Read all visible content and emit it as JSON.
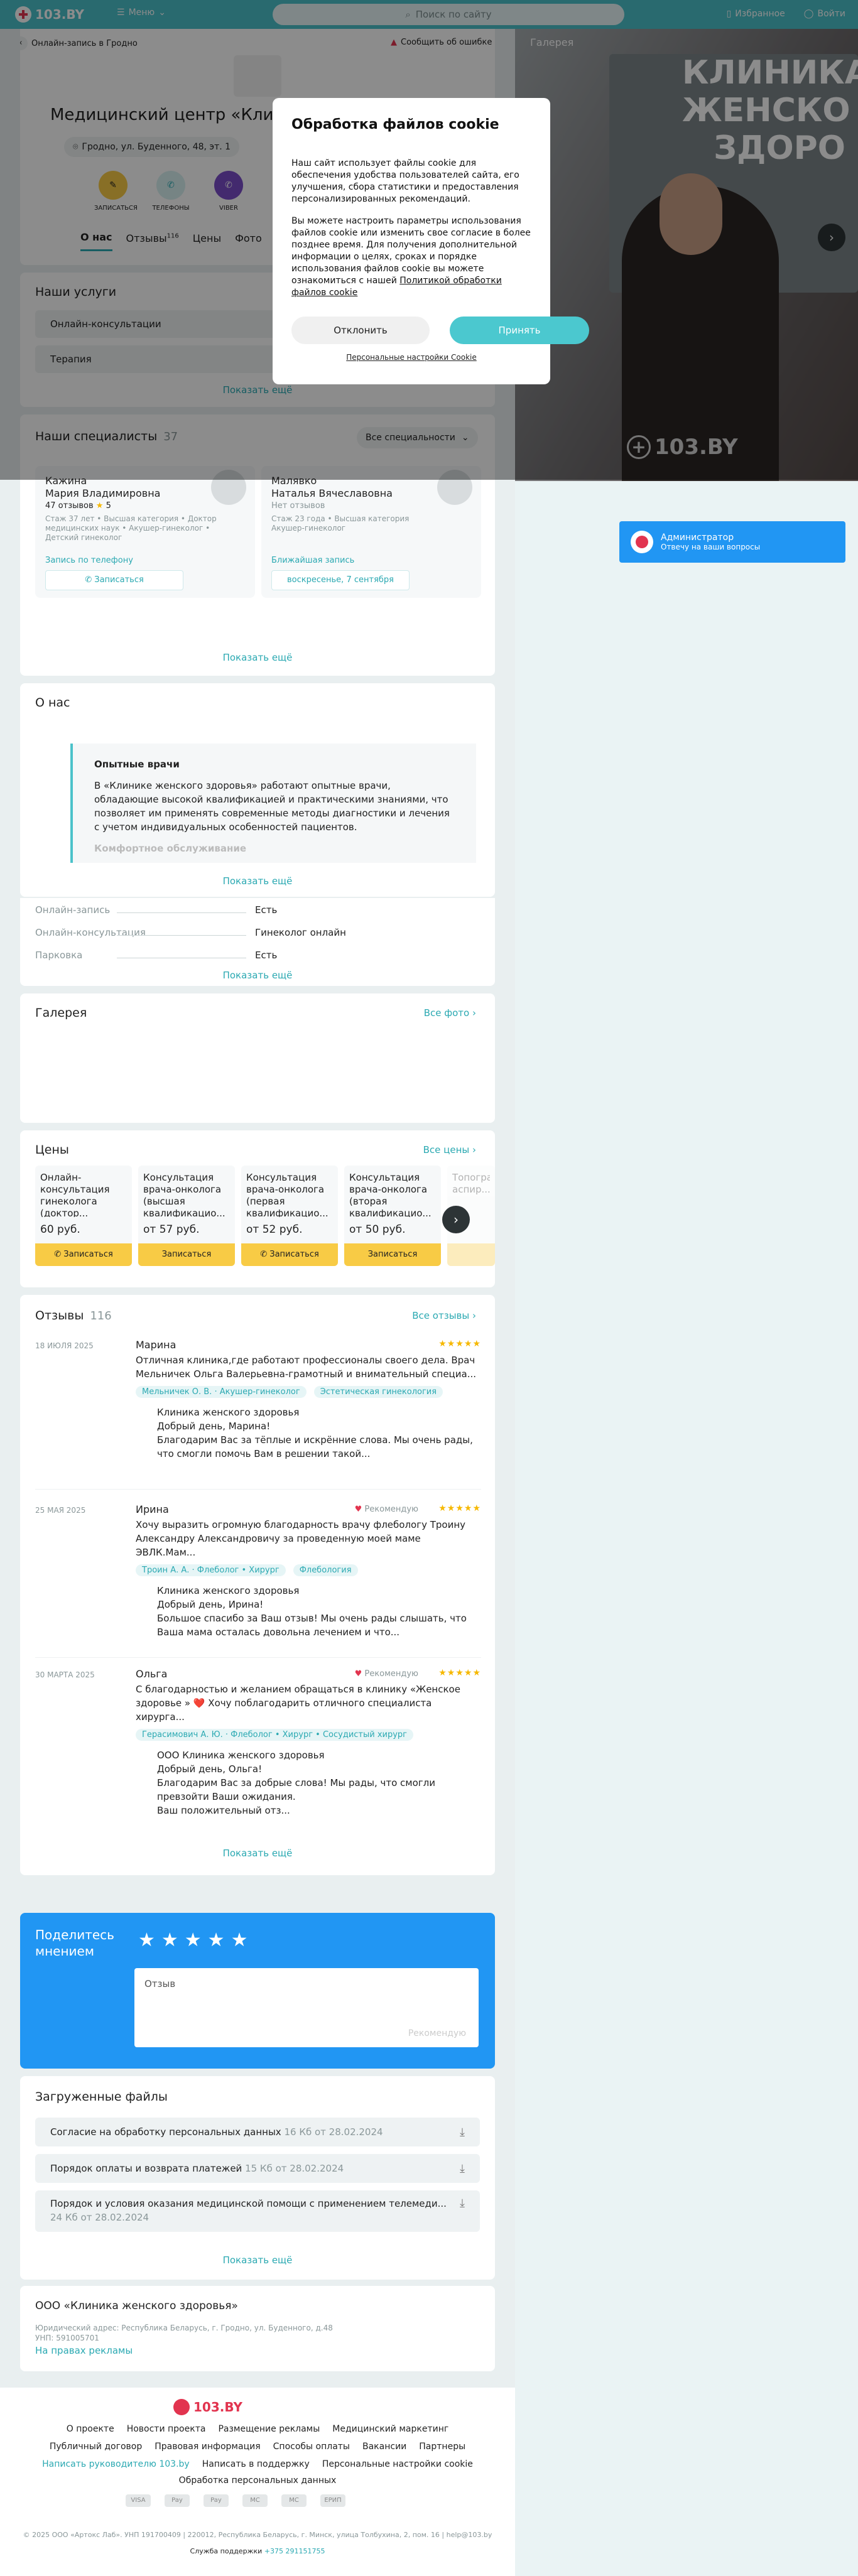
{
  "header": {
    "logo": "103.BY",
    "menu": "Меню",
    "search_placeholder": "Поиск по сайту",
    "favorites": "Избранное",
    "login": "Войти"
  },
  "crumbs": {
    "back": "Онлайн-запись в Гродно",
    "report": "Сообщить об ошибке"
  },
  "clinic": {
    "title": "Медицинский центр «Клиника женского здоровья»",
    "address": "Гродно, ул. Буденного, 48, эт. 1",
    "actions": [
      "ЗАПИСАТЬСЯ",
      "ТЕЛЕФОНЫ",
      "VIBER"
    ],
    "tabs": [
      {
        "label": "О нас"
      },
      {
        "label": "Отзывы",
        "count": "116"
      },
      {
        "label": "Цены"
      },
      {
        "label": "Фото"
      }
    ]
  },
  "gallery_pane": {
    "label": "Галерея",
    "banner_text": "КЛИНИКА ЖЕНСКО ЗДОРО",
    "watermark": "103.BY"
  },
  "cookie": {
    "title": "Обработка файлов cookie",
    "p1": "Наш сайт использует файлы cookie для обеспечения удобства пользователей сайта, его улучшения, сбора статистики и предоставления персонализированных рекомендаций.",
    "p2": "Вы можете настроить параметры использования файлов cookie или изменить свое согласие в более позднее время. Для получения дополнительной информации о целях, сроках и порядке использования файлов cookie вы можете ознакомиться с нашей",
    "policy_link": "Политикой обработки файлов cookie",
    "decline": "Отклонить",
    "accept": "Принять",
    "settings": "Персональные настройки Cookie"
  },
  "admin": {
    "title": "Администратор",
    "subtitle": "Отвечу на ваши вопросы"
  },
  "services": {
    "title": "Наши услуги",
    "items": [
      "Онлайн-консультации",
      "Терапия"
    ],
    "more": "Показать ещё"
  },
  "specialists": {
    "title": "Наши специалисты",
    "count": "37",
    "filter": "Все специальности",
    "items": [
      {
        "name": "Кажина\nМария Владимировна",
        "reviews": "47 отзывов",
        "rating": "5",
        "info": "Стаж 37 лет • Высшая категория • Доктор медицинских наук • Акушер-гинеколог • Детский гинеколог",
        "note": "Запись по телефону",
        "cta": "Записаться"
      },
      {
        "name": "Малявко\nНаталья Вячеславовна",
        "reviews": "Нет отзывов",
        "rating": "",
        "info": "Стаж 23 года • Высшая категория\nАкушер-гинеколог",
        "note": "Ближайшая запись",
        "cta": "воскресенье, 7 сентября"
      }
    ],
    "more": "Показать ещё"
  },
  "about": {
    "title": "О нас",
    "quote_title": "Опытные врачи",
    "quote_text": "В «Клинике женского здоровья» работают опытные врачи, обладающие высокой квалификацией и практическими знаниями, что позволяет им применять современные методы диагностики и лечения с учетом индивидуальных особенностей пациентов.",
    "next_title": "Комфортное обслуживание",
    "more": "Показать ещё"
  },
  "features": {
    "items": [
      {
        "key": "Онлайн-запись",
        "value": "Есть"
      },
      {
        "key": "Онлайн-консультация",
        "value": "Гинеколог онлайн"
      },
      {
        "key": "Парковка",
        "value": "Есть"
      }
    ],
    "more": "Показать ещё"
  },
  "gallery": {
    "title": "Галерея",
    "all": "Все фото"
  },
  "prices": {
    "title": "Цены",
    "all": "Все цены",
    "items": [
      {
        "title": "Онлайн-консультация гинеколога (доктор...",
        "price": "60 руб.",
        "button": "Записаться"
      },
      {
        "title": "Консультация врача-онколога (высшая квалификацио...",
        "price": "от 57 руб.",
        "button": "Записаться"
      },
      {
        "title": "Консультация врача-онколога (первая квалификацио...",
        "price": "от 52 руб.",
        "button": "Записаться"
      },
      {
        "title": "Консультация врача-онколога (вторая квалификацио...",
        "price": "от 50 руб.",
        "button": "Записаться"
      },
      {
        "title": "Топография аспир...",
        "price": "",
        "button": ""
      }
    ]
  },
  "reviews": {
    "title": "Отзывы",
    "count": "116",
    "all": "Все отзывы",
    "items": [
      {
        "date": "18 ИЮЛЯ 2025",
        "name": "Марина",
        "stars": "★★★★★",
        "recommend": "",
        "text": "Отличная клиника,где работают профессионалы своего дела. Врач Мельничек Ольга Валерьевна-грамотный и внимательный специа...",
        "tags": [
          "Мельничек О. В. · Акушер-гинеколог",
          "Эстетическая гинекология"
        ],
        "answer": "Клиника женского здоровья\nДобрый день, Марина!\nБлагодарим Вас за тёплые и искрённие слова. Мы очень рады, что смогли помочь Вам в решении такой..."
      },
      {
        "date": "25 МАЯ 2025",
        "name": "Ирина",
        "stars": "★★★★★",
        "recommend": "Рекомендую",
        "text": "Хочу выразить огромную благодарность врачу флебологу Троину Александру Александровичу за проведенную моей маме ЭВЛК.Мам...",
        "tags": [
          "Троин А. А. · Флеболог • Хирург",
          "Флебология"
        ],
        "answer": "Клиника женского здоровья\nДобрый день, Ирина!\nБольшое спасибо за Ваш отзыв! Мы очень рады слышать, что Ваша мама осталась довольна лечением и что..."
      },
      {
        "date": "30 МАРТА 2025",
        "name": "Ольга",
        "stars": "★★★★★",
        "recommend": "Рекомендую",
        "text": "С благодарностью и желанием обращаться в клинику «Женское здоровье » ❤️ Хочу поблагодарить отличного специалиста хирурга...",
        "tags": [
          "Герасимович А. Ю. · Флеболог • Хирург • Сосудистый хирург"
        ],
        "answer": "ООО Клиника женского здоровья\nДобрый день, Ольга!\nБлагодарим Вас за добрые слова! Мы рады, что смогли превзойти Ваши ожидания.\nВаш положительный отз..."
      }
    ],
    "more": "Показать ещё"
  },
  "feedback": {
    "label": "Поделитесь мнением",
    "stars": "★★★★★",
    "placeholder": "Отзыв",
    "submit": "Рекомендую"
  },
  "files": {
    "title": "Загруженные файлы",
    "items": [
      {
        "name": "Согласие на обработку персональных данных",
        "meta": "16 Кб от 28.02.2024"
      },
      {
        "name": "Порядок оплаты и возврата платежей",
        "meta": "15 Кб от 28.02.2024"
      },
      {
        "name": "Порядок и условия оказания медицинской помощи с применением телемеди...",
        "meta": "24 Кб от 28.02.2024"
      }
    ],
    "more": "Показать ещё"
  },
  "legal": {
    "name": "ООО «Клиника женского здоровья»",
    "address": "Юридический адрес: Республика Беларусь, г. Гродно, ул. Буденного, д.48",
    "unp": "УНП: 591005701",
    "ad": "На правах рекламы"
  },
  "footer": {
    "logo": "103.BY",
    "row1": [
      "О проекте",
      "Новости проекта",
      "Размещение рекламы",
      "Медицинский маркетинг"
    ],
    "row2": [
      "Публичный договор",
      "Правовая информация",
      "Способы оплаты",
      "Вакансии",
      "Партнеры"
    ],
    "row3": [
      "Написать руководителю 103.by",
      "Написать в поддержку",
      "Персональные настройки cookie"
    ],
    "row4": [
      "Обработка персональных данных"
    ],
    "pay": [
      "VISA",
      "Pay",
      "Pay",
      "MC",
      "MC",
      "ЕРИП"
    ],
    "copyright": "© 2025 ООО «Артокс Лаб». УНП 191700409 | 220012, Республика Беларусь, г. Минск, улица Толбухина, 2, пом. 16 | help@103.by",
    "support": "Служба поддержки",
    "phone": "+375 291151755"
  }
}
